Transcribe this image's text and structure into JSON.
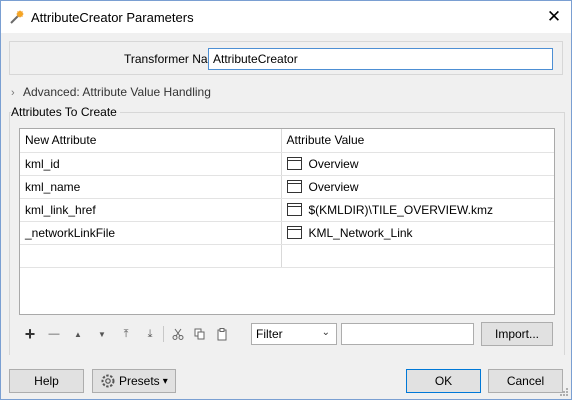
{
  "window": {
    "title": "AttributeCreator Parameters",
    "close_glyph": "✕"
  },
  "transformer": {
    "label": "Transformer Name:",
    "value": "AttributeCreator"
  },
  "advanced": {
    "label": "Advanced: Attribute Value Handling",
    "chevron": "›"
  },
  "attributes": {
    "group_label": "Attributes To Create",
    "columns": [
      "New Attribute",
      "Attribute Value"
    ],
    "rows": [
      {
        "name": "kml_id",
        "value": "Overview"
      },
      {
        "name": "kml_name",
        "value": "Overview"
      },
      {
        "name": "kml_link_href",
        "value": "$(KMLDIR)\\TILE_OVERVIEW.kmz"
      },
      {
        "name": "_networkLinkFile",
        "value": "KML_Network_Link"
      },
      {
        "name": "",
        "value": ""
      }
    ]
  },
  "toolbar": {
    "add": "+",
    "remove": "—",
    "up": "▲",
    "down": "▼",
    "top": "⤒",
    "bottom": "⤓",
    "filter_value": "Filter",
    "filter_arrow": "⌄",
    "import_label": "Import..."
  },
  "footer": {
    "help_label": "Help",
    "presets_label": "Presets",
    "presets_arrow": "▾",
    "ok_label": "OK",
    "cancel_label": "Cancel"
  },
  "colors": {
    "accent": "#0078d7",
    "input_border": "#4d8fd4"
  },
  "icons": [
    "fme-app-icon",
    "close-icon",
    "add-icon",
    "remove-icon",
    "move-up-icon",
    "move-down-icon",
    "move-top-icon",
    "move-bottom-icon",
    "cut-icon",
    "copy-icon",
    "paste-icon",
    "presets-gear-icon",
    "text-value-icon"
  ]
}
